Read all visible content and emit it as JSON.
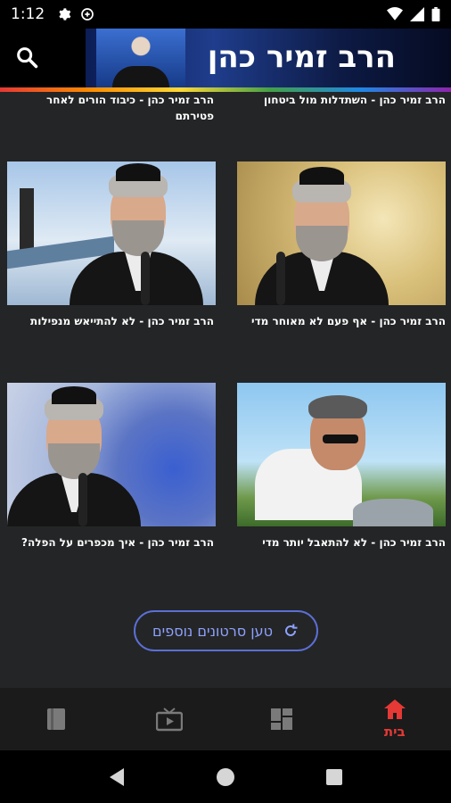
{
  "status_bar": {
    "time": "1:12",
    "icons_left": [
      "gear-icon",
      "sync-icon"
    ],
    "icons_right": [
      "wifi-icon",
      "signal-icon",
      "battery-icon"
    ]
  },
  "header": {
    "title": "הרב זמיר כהן",
    "search_icon": "search-icon"
  },
  "videos": [
    {
      "title": "הרב זמיר כהן - השתדלות מול ביטחון"
    },
    {
      "title": "הרב זמיר כהן - כיבוד הורים לאחר פטירתם"
    },
    {
      "title": "הרב זמיר כהן - אף פעם לא מאוחר מדי"
    },
    {
      "title": "הרב זמיר כהן - לא להתייאש מנפילות"
    },
    {
      "title": "הרב זמיר כהן - לא להתאבל יותר מדי"
    },
    {
      "title": "הרב זמיר כהן - איך מכפרים על הפלה?"
    }
  ],
  "load_more": {
    "label": "טען סרטונים נוספים",
    "icon": "refresh-icon"
  },
  "bottom_nav": {
    "items": [
      {
        "icon": "book-icon",
        "label": ""
      },
      {
        "icon": "tv-icon",
        "label": ""
      },
      {
        "icon": "dashboard-icon",
        "label": ""
      },
      {
        "icon": "home-icon",
        "label": "בית",
        "active": true
      }
    ],
    "active_color": "#e53935"
  },
  "system_nav": [
    "back-icon",
    "home-circle-icon",
    "recents-icon"
  ]
}
